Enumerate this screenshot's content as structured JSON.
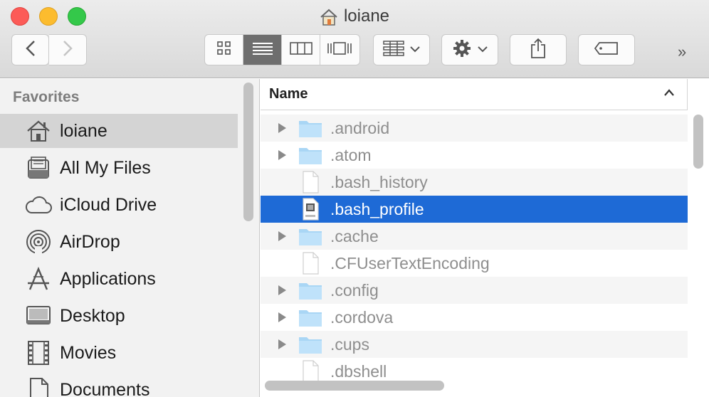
{
  "window": {
    "title": "loiane",
    "title_icon": "home-icon"
  },
  "toolbar": {
    "back": "back-chevron-icon",
    "forward": "forward-chevron-icon",
    "view_modes": [
      "icon-view",
      "list-view",
      "column-view",
      "coverflow-view"
    ],
    "active_view": "list-view",
    "arrange": "arrange-icon",
    "action": "gear-icon",
    "share": "share-icon",
    "tags": "tag-icon",
    "overflow": "»"
  },
  "sidebar": {
    "heading": "Favorites",
    "items": [
      {
        "label": "loiane",
        "icon": "home-icon",
        "selected": true
      },
      {
        "label": "All My Files",
        "icon": "all-files-icon",
        "selected": false
      },
      {
        "label": "iCloud Drive",
        "icon": "cloud-icon",
        "selected": false
      },
      {
        "label": "AirDrop",
        "icon": "airdrop-icon",
        "selected": false
      },
      {
        "label": "Applications",
        "icon": "applications-icon",
        "selected": false
      },
      {
        "label": "Desktop",
        "icon": "desktop-icon",
        "selected": false
      },
      {
        "label": "Movies",
        "icon": "film-icon",
        "selected": false
      },
      {
        "label": "Documents",
        "icon": "document-icon",
        "selected": false
      }
    ]
  },
  "list": {
    "column_header": "Name",
    "rows": [
      {
        "name": ".android",
        "kind": "folder"
      },
      {
        "name": ".atom",
        "kind": "folder"
      },
      {
        "name": ".bash_history",
        "kind": "file"
      },
      {
        "name": ".bash_profile",
        "kind": "shell",
        "selected": true
      },
      {
        "name": ".cache",
        "kind": "folder"
      },
      {
        "name": ".CFUserTextEncoding",
        "kind": "file"
      },
      {
        "name": ".config",
        "kind": "folder"
      },
      {
        "name": ".cordova",
        "kind": "folder"
      },
      {
        "name": ".cups",
        "kind": "folder"
      },
      {
        "name": ".dbshell",
        "kind": "file"
      }
    ]
  },
  "colors": {
    "selection": "#1e6ad6",
    "folder": "#a9d6f5",
    "sidebar_bg": "#f2f2f2"
  }
}
